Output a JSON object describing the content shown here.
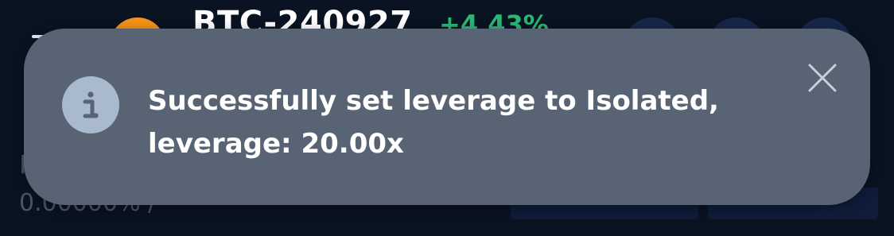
{
  "header": {
    "pair_title": "BTC-240927",
    "change": "+4.43%",
    "menu_icon": "menu-icon",
    "coin_icon": "bitcoin-logo",
    "coin_color": "#f7931a",
    "change_color": "#28b877"
  },
  "background": {
    "funding_label": "F",
    "funding_value": "0.00000% / -"
  },
  "toast": {
    "icon": "info-icon",
    "message": "Successfully set leverage to Isolated,\nleverage: 20.00x",
    "close_icon": "close-icon",
    "background_color": "#586473",
    "icon_color": "#a9bacf"
  }
}
